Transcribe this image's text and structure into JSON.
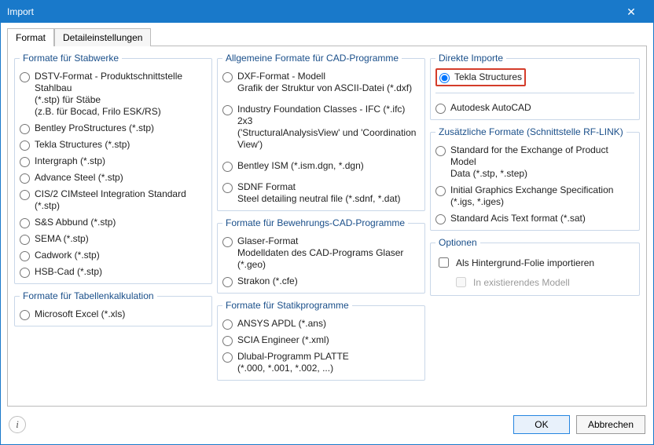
{
  "window": {
    "title": "Import"
  },
  "tabs": {
    "format": "Format",
    "detail": "Detaileinstellungen"
  },
  "col1": {
    "groupA": {
      "legend": "Formate für Stabwerke",
      "items": [
        {
          "line1": "DSTV-Format - Produktschnittstelle Stahlbau",
          "line2": "(*.stp) für Stäbe",
          "line3": "(z.B. für Bocad, Frilo ESK/RS)"
        },
        {
          "line1": "Bentley ProStructures (*.stp)"
        },
        {
          "line1": "Tekla Structures (*.stp)"
        },
        {
          "line1": "Intergraph (*.stp)"
        },
        {
          "line1": "Advance Steel (*.stp)"
        },
        {
          "line1": "CIS/2 CIMsteel Integration Standard (*.stp)"
        },
        {
          "line1": "S&S Abbund (*.stp)"
        },
        {
          "line1": "SEMA (*.stp)"
        },
        {
          "line1": "Cadwork (*.stp)"
        },
        {
          "line1": "HSB-Cad (*.stp)"
        }
      ]
    },
    "groupB": {
      "legend": "Formate für Tabellenkalkulation",
      "items": [
        {
          "line1": "Microsoft Excel (*.xls)"
        }
      ]
    }
  },
  "col2": {
    "groupA": {
      "legend": "Allgemeine Formate für CAD-Programme",
      "items": [
        {
          "line1": "DXF-Format - Modell",
          "line2": "Grafik der Struktur von ASCII-Datei (*.dxf)"
        },
        {
          "line1": "Industry Foundation Classes - IFC (*.ifc) 2x3",
          "line2": "('StructuralAnalysisView' und 'Coordination View')"
        },
        {
          "line1": "Bentley ISM (*.ism.dgn, *.dgn)"
        },
        {
          "line1": "SDNF Format",
          "line2": "Steel detailing neutral file (*.sdnf, *.dat)"
        }
      ]
    },
    "groupB": {
      "legend": "Formate für Bewehrungs-CAD-Programme",
      "items": [
        {
          "line1": "Glaser-Format",
          "line2": "Modelldaten des CAD-Programs Glaser (*.geo)"
        },
        {
          "line1": "Strakon (*.cfe)"
        }
      ]
    },
    "groupC": {
      "legend": "Formate für Statikprogramme",
      "items": [
        {
          "line1": "ANSYS APDL (*.ans)"
        },
        {
          "line1": "SCIA Engineer (*.xml)"
        },
        {
          "line1": "Dlubal-Programm PLATTE",
          "line2": "(*.000, *.001, *.002, ...)"
        }
      ]
    }
  },
  "col3": {
    "groupA": {
      "legend": "Direkte Importe",
      "selected": "Tekla Structures",
      "other": "Autodesk AutoCAD"
    },
    "groupB": {
      "legend": "Zusätzliche Formate (Schnittstelle RF-LINK)",
      "items": [
        {
          "line1": "Standard for the Exchange of Product Model",
          "line2": "Data (*.stp, *.step)"
        },
        {
          "line1": "Initial Graphics Exchange Specification",
          "line2": "(*.igs, *.iges)"
        },
        {
          "line1": "Standard Acis Text format (*.sat)"
        }
      ]
    },
    "groupC": {
      "legend": "Optionen",
      "opt1": "Als Hintergrund-Folie importieren",
      "opt2": "In existierendes Modell"
    }
  },
  "buttons": {
    "ok": "OK",
    "cancel": "Abbrechen"
  }
}
